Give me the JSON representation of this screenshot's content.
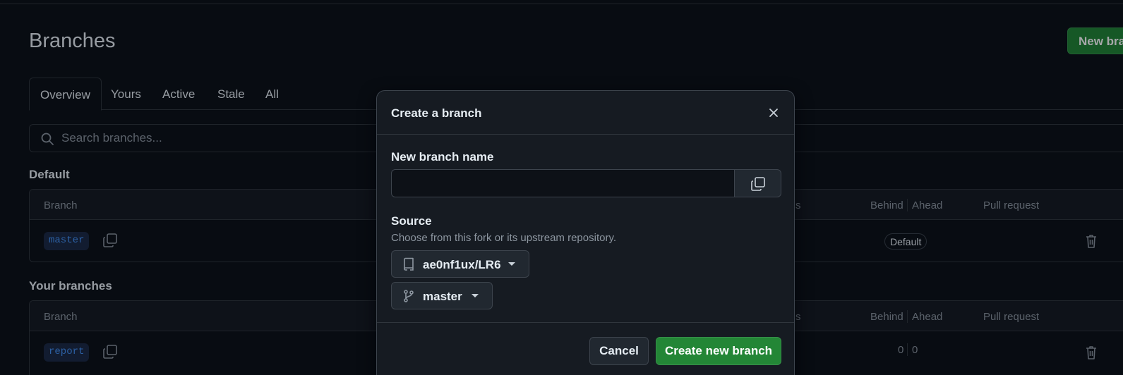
{
  "page": {
    "title": "Branches",
    "new_branch_label": "New branch"
  },
  "tabs": [
    {
      "label": "Overview",
      "selected": true
    },
    {
      "label": "Yours"
    },
    {
      "label": "Active"
    },
    {
      "label": "Stale"
    },
    {
      "label": "All"
    }
  ],
  "search": {
    "placeholder": "Search branches..."
  },
  "default_section": {
    "label": "Default",
    "columns": {
      "branch": "Branch",
      "status": "Status",
      "behind": "Behind",
      "ahead": "Ahead",
      "pull_request": "Pull request"
    },
    "rows": [
      {
        "name": "master",
        "badge": "Default"
      }
    ]
  },
  "your_section": {
    "label": "Your branches",
    "columns": {
      "branch": "Branch",
      "status": "Status",
      "behind": "Behind",
      "ahead": "Ahead",
      "pull_request": "Pull request"
    },
    "rows": [
      {
        "name": "report",
        "behind": "0",
        "ahead": "0"
      }
    ]
  },
  "dialog": {
    "title": "Create a branch",
    "name_label": "New branch name",
    "name_value": "",
    "source_label": "Source",
    "source_caption": "Choose from this fork or its upstream repository.",
    "repo": "ae0nf1ux/LR6",
    "branch": "master",
    "cancel_label": "Cancel",
    "create_label": "Create new branch"
  },
  "colors": {
    "accent_green": "#238636",
    "link_blue": "#4493f8",
    "background": "#0d1117"
  }
}
